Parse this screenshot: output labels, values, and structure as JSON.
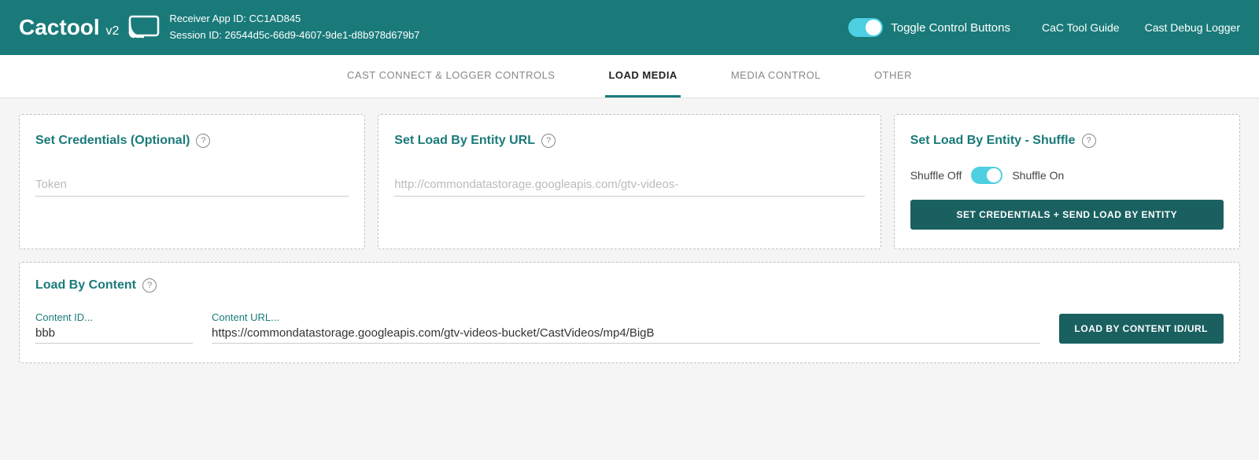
{
  "header": {
    "logo_text": "Cactool",
    "logo_version": "v2",
    "receiver_app_id_label": "Receiver App ID: CC1AD845",
    "session_id_label": "Session ID: 26544d5c-66d9-4607-9de1-d8b978d679b7",
    "toggle_label": "Toggle Control Buttons",
    "links": [
      {
        "label": "CaC Tool Guide"
      },
      {
        "label": "Cast Debug Logger"
      }
    ]
  },
  "nav": {
    "tabs": [
      {
        "label": "CAST CONNECT & LOGGER CONTROLS",
        "active": false
      },
      {
        "label": "LOAD MEDIA",
        "active": true
      },
      {
        "label": "MEDIA CONTROL",
        "active": false
      },
      {
        "label": "OTHER",
        "active": false
      }
    ]
  },
  "cards": {
    "credentials": {
      "title": "Set Credentials (Optional)",
      "token_placeholder": "Token"
    },
    "load_by_entity_url": {
      "title": "Set Load By Entity URL",
      "url_placeholder": "http://commondatastorage.googleapis.com/gtv-videos-"
    },
    "shuffle": {
      "title": "Set Load By Entity - Shuffle",
      "shuffle_off_label": "Shuffle Off",
      "shuffle_on_label": "Shuffle On",
      "button_label": "SET CREDENTIALS + SEND LOAD BY ENTITY"
    },
    "load_by_content": {
      "title": "Load By Content",
      "content_id_label": "Content ID...",
      "content_id_value": "bbb",
      "content_url_label": "Content URL...",
      "content_url_value": "https://commondatastorage.googleapis.com/gtv-videos-bucket/CastVideos/mp4/BigB",
      "button_label": "LOAD BY CONTENT ID/URL"
    }
  },
  "colors": {
    "teal": "#1a7a7a",
    "teal_dark": "#1a6060",
    "teal_light": "#4dd0e1"
  }
}
